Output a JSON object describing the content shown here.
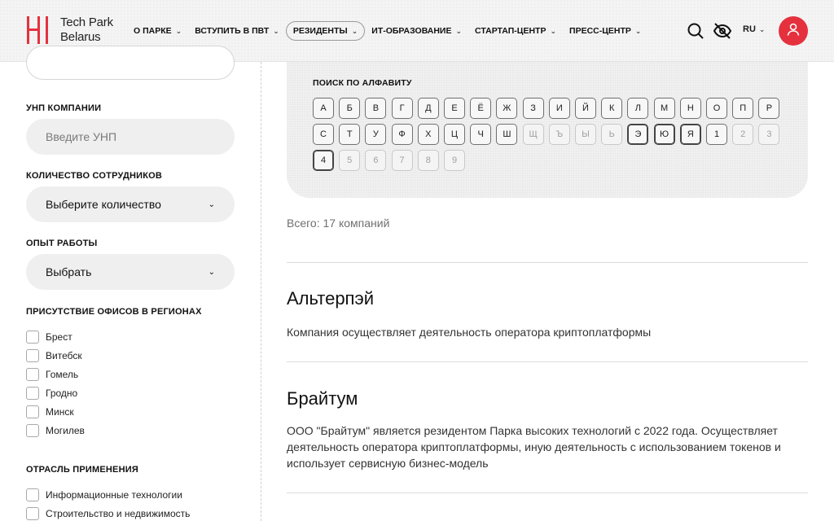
{
  "header": {
    "logo_line1": "Tech Park",
    "logo_line2": "Belarus",
    "nav": [
      {
        "label": "О ПАРКЕ",
        "chevron": "⌄"
      },
      {
        "label": "ВСТУПИТЬ В ПВТ",
        "chevron": "⌄"
      },
      {
        "label": "РЕЗИДЕНТЫ",
        "chevron": "⌄"
      },
      {
        "label": "ИТ-ОБРАЗОВАНИЕ",
        "chevron": "⌄"
      },
      {
        "label": "СТАРТАП-ЦЕНТР",
        "chevron": "⌄"
      },
      {
        "label": "ПРЕСС-ЦЕНТР",
        "chevron": "⌄"
      }
    ],
    "lang": "RU",
    "lang_chevron": "⌄",
    "accent_color": "#e5313e"
  },
  "sidebar": {
    "unp_label": "УНП КОМПАНИИ",
    "unp_placeholder": "Введите УНП",
    "employees_label": "КОЛИЧЕСТВО СОТРУДНИКОВ",
    "employees_value": "Выберите количество",
    "experience_label": "ОПЫТ РАБОТЫ",
    "experience_value": "Выбрать",
    "select_chevron": "⌄",
    "regions_label": "ПРИСУТСТВИЕ ОФИСОВ В РЕГИОНАХ",
    "regions": [
      "Брест",
      "Витебск",
      "Гомель",
      "Гродно",
      "Минск",
      "Могилев"
    ],
    "industry_label": "ОТРАСЛЬ ПРИМЕНЕНИЯ",
    "industries": [
      "Информационные технологии",
      "Строительство и недвижимость"
    ]
  },
  "alphabet": {
    "title": "ПОИСК ПО АЛФАВИТУ",
    "row1": [
      {
        "ch": "А",
        "on": true
      },
      {
        "ch": "Б",
        "on": true
      },
      {
        "ch": "В",
        "on": true
      },
      {
        "ch": "Г",
        "on": true
      },
      {
        "ch": "Д",
        "on": true
      },
      {
        "ch": "Е",
        "on": true
      },
      {
        "ch": "Ё",
        "on": true
      },
      {
        "ch": "Ж",
        "on": true
      },
      {
        "ch": "З",
        "on": true
      },
      {
        "ch": "И",
        "on": true
      },
      {
        "ch": "Й",
        "on": true
      },
      {
        "ch": "К",
        "on": true
      },
      {
        "ch": "Л",
        "on": true
      },
      {
        "ch": "М",
        "on": true
      },
      {
        "ch": "Н",
        "on": true
      },
      {
        "ch": "О",
        "on": true
      },
      {
        "ch": "П",
        "on": true
      },
      {
        "ch": "Р",
        "on": true
      }
    ],
    "row2": [
      {
        "ch": "С",
        "on": true
      },
      {
        "ch": "Т",
        "on": true
      },
      {
        "ch": "У",
        "on": true
      },
      {
        "ch": "Ф",
        "on": true
      },
      {
        "ch": "Х",
        "on": true
      },
      {
        "ch": "Ц",
        "on": true
      },
      {
        "ch": "Ч",
        "on": true
      },
      {
        "ch": "Ш",
        "on": true
      },
      {
        "ch": "Щ",
        "on": false
      },
      {
        "ch": "Ъ",
        "on": false
      },
      {
        "ch": "Ы",
        "on": false
      },
      {
        "ch": "Ь",
        "on": false
      },
      {
        "ch": "Э",
        "on": true,
        "sel": true
      },
      {
        "ch": "Ю",
        "on": true,
        "sel": true
      },
      {
        "ch": "Я",
        "on": true,
        "sel": true
      },
      {
        "ch": "1",
        "on": true
      },
      {
        "ch": "2",
        "on": false
      },
      {
        "ch": "3",
        "on": false
      }
    ],
    "row3": [
      {
        "ch": "4",
        "on": true,
        "sel": true
      },
      {
        "ch": "5",
        "on": false
      },
      {
        "ch": "6",
        "on": false
      },
      {
        "ch": "7",
        "on": false
      },
      {
        "ch": "8",
        "on": false
      },
      {
        "ch": "9",
        "on": false
      }
    ]
  },
  "results": {
    "total": "Всего: 17 компаний",
    "companies": [
      {
        "name": "Альтерпэй",
        "description": "Компания осуществляет деятельность оператора криптоплатформы"
      },
      {
        "name": "Брайтум",
        "description": "ООО \"Брайтум\" является резидентом Парка высоких технологий с 2022 года. Осуществляет деятельность оператора криптоплатформы, иную деятельность с использованием токенов и использует сервисную бизнес-модель"
      }
    ]
  }
}
